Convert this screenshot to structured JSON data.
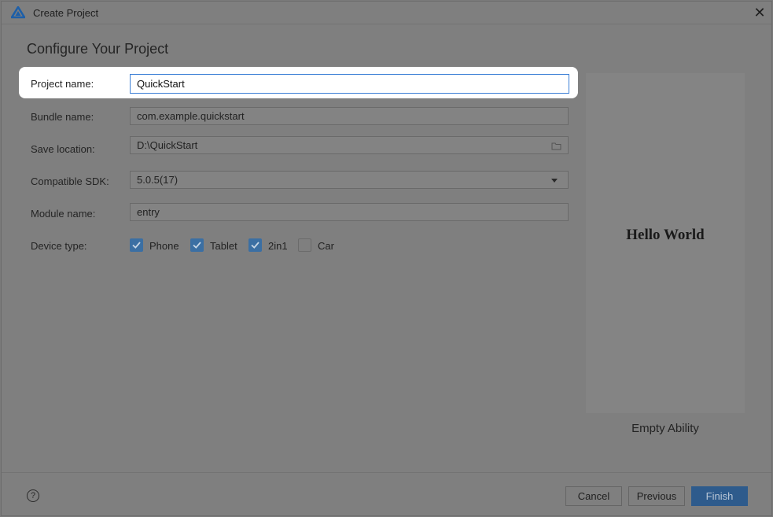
{
  "window": {
    "title": "Create Project",
    "close_glyph": "✕",
    "icon": "deveco-logo-icon"
  },
  "page": {
    "heading": "Configure Your Project"
  },
  "form": {
    "project_name": {
      "label": "Project name:",
      "value": "QuickStart"
    },
    "bundle_name": {
      "label": "Bundle name:",
      "value": "com.example.quickstart"
    },
    "save_location": {
      "label": "Save location:",
      "value": "D:\\QuickStart",
      "icon": "folder-icon"
    },
    "compatible_sdk": {
      "label": "Compatible SDK:",
      "value": "5.0.5(17)"
    },
    "module_name": {
      "label": "Module name:",
      "value": "entry"
    },
    "device_type": {
      "label": "Device type:",
      "options": [
        {
          "label": "Phone",
          "checked": true
        },
        {
          "label": "Tablet",
          "checked": true
        },
        {
          "label": "2in1",
          "checked": true
        },
        {
          "label": "Car",
          "checked": false
        }
      ]
    }
  },
  "preview": {
    "text": "Hello World",
    "template_name": "Empty Ability"
  },
  "footer": {
    "help_glyph": "?",
    "cancel_label": "Cancel",
    "previous_label": "Previous",
    "finish_label": "Finish"
  },
  "colors": {
    "accent": "#3c7fd6",
    "primary_button": "#2e5b8c",
    "overlay": "#7f7f7f",
    "highlight": "#ffffff"
  }
}
